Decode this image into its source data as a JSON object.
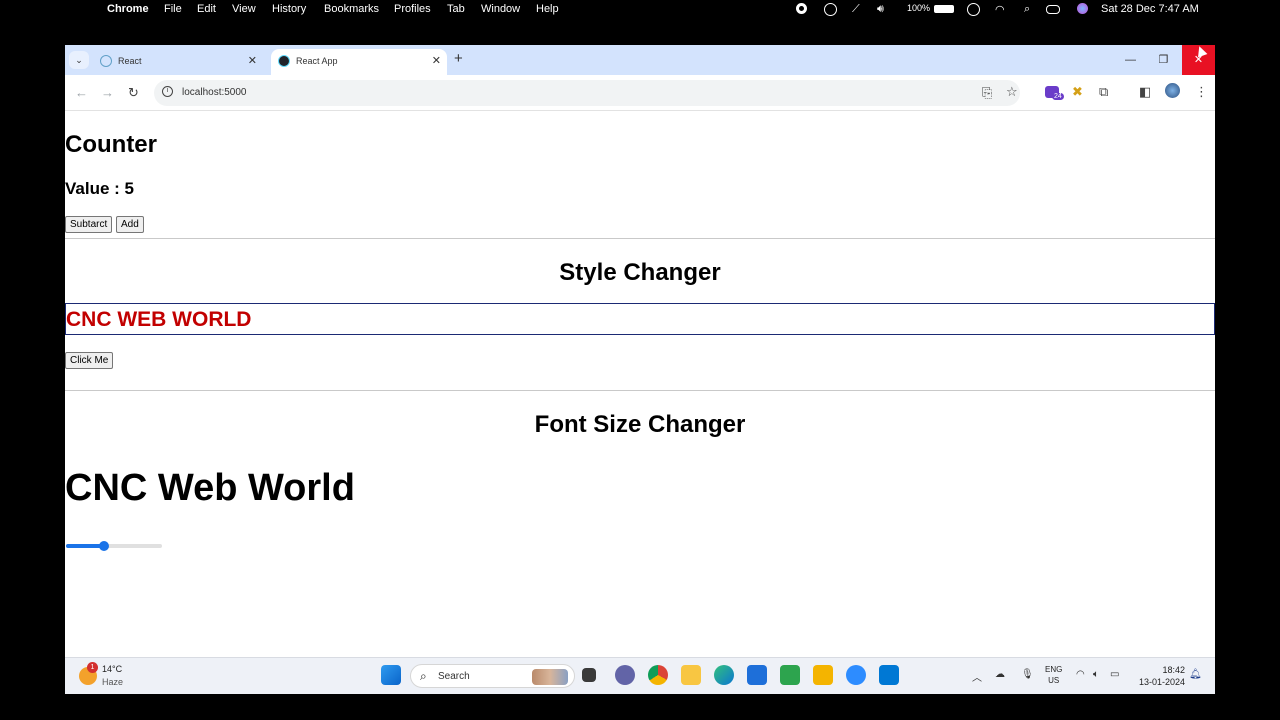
{
  "menubar": {
    "app": "Chrome",
    "items": [
      "File",
      "Edit",
      "View",
      "History",
      "Bookmarks",
      "Profiles",
      "Tab",
      "Window",
      "Help"
    ],
    "battery": "100%",
    "datetime": "Sat 28 Dec  7:47 AM"
  },
  "browser": {
    "tabs": [
      {
        "label": "React",
        "icon": "react-icon"
      },
      {
        "label": "React App",
        "icon": "react-icon"
      }
    ],
    "url": "localhost:5000",
    "extension_badge": "24"
  },
  "page": {
    "counter": {
      "title": "Counter",
      "value_text": "Value : 5",
      "subtract_label": "Subtarct",
      "add_label": "Add"
    },
    "style_changer": {
      "title": "Style Changer",
      "text": "CNC WEB WORLD",
      "text_color": "#c20000",
      "button_label": "Click Me"
    },
    "font_size_changer": {
      "title": "Font Size Changer",
      "text": "CNC Web World",
      "slider_fraction": 0.38
    }
  },
  "taskbar": {
    "weather_badge": "1",
    "temperature": "14°C",
    "condition": "Haze",
    "search_label": "Search",
    "lang_line1": "ENG",
    "lang_line2": "US",
    "time": "18:42",
    "date": "13-01-2024"
  }
}
